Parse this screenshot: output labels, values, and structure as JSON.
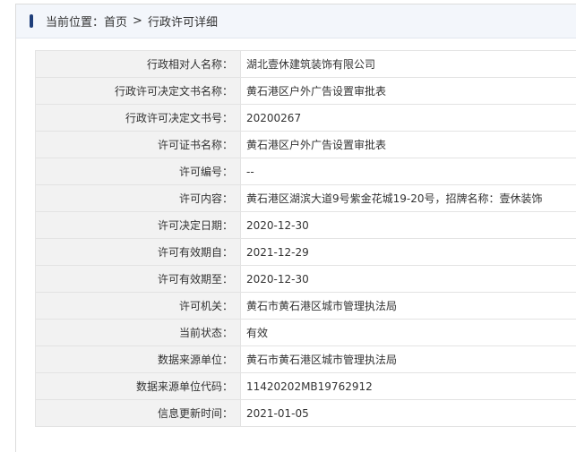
{
  "breadcrumb": {
    "prefix": "当前位置：",
    "home": "首页",
    "separator": ">",
    "current": "行政许可详细"
  },
  "rows": [
    {
      "label": "行政相对人名称：",
      "value": "湖北壹休建筑装饰有限公司"
    },
    {
      "label": "行政许可决定文书名称：",
      "value": "黄石港区户外广告设置审批表"
    },
    {
      "label": "行政许可决定文书号：",
      "value": "20200267"
    },
    {
      "label": "许可证书名称：",
      "value": "黄石港区户外广告设置审批表"
    },
    {
      "label": "许可编号：",
      "value": "--"
    },
    {
      "label": "许可内容：",
      "value": "黄石港区湖滨大道9号紫金花城19-20号，招牌名称：壹休装饰"
    },
    {
      "label": "许可决定日期：",
      "value": "2020-12-30"
    },
    {
      "label": "许可有效期自：",
      "value": "2021-12-29"
    },
    {
      "label": "许可有效期至：",
      "value": "2020-12-30"
    },
    {
      "label": "许可机关：",
      "value": "黄石市黄石港区城市管理执法局"
    },
    {
      "label": "当前状态：",
      "value": "有效"
    },
    {
      "label": "数据来源单位：",
      "value": "黄石市黄石港区城市管理执法局"
    },
    {
      "label": "数据来源单位代码：",
      "value": "11420202MB19762912"
    },
    {
      "label": "信息更新时间：",
      "value": "2021-01-05"
    }
  ],
  "colors": {
    "accent": "#1f3f7a",
    "header_bg": "#f3f6fb",
    "label_bg": "#f2f2f2",
    "border": "#e3e3e3"
  }
}
